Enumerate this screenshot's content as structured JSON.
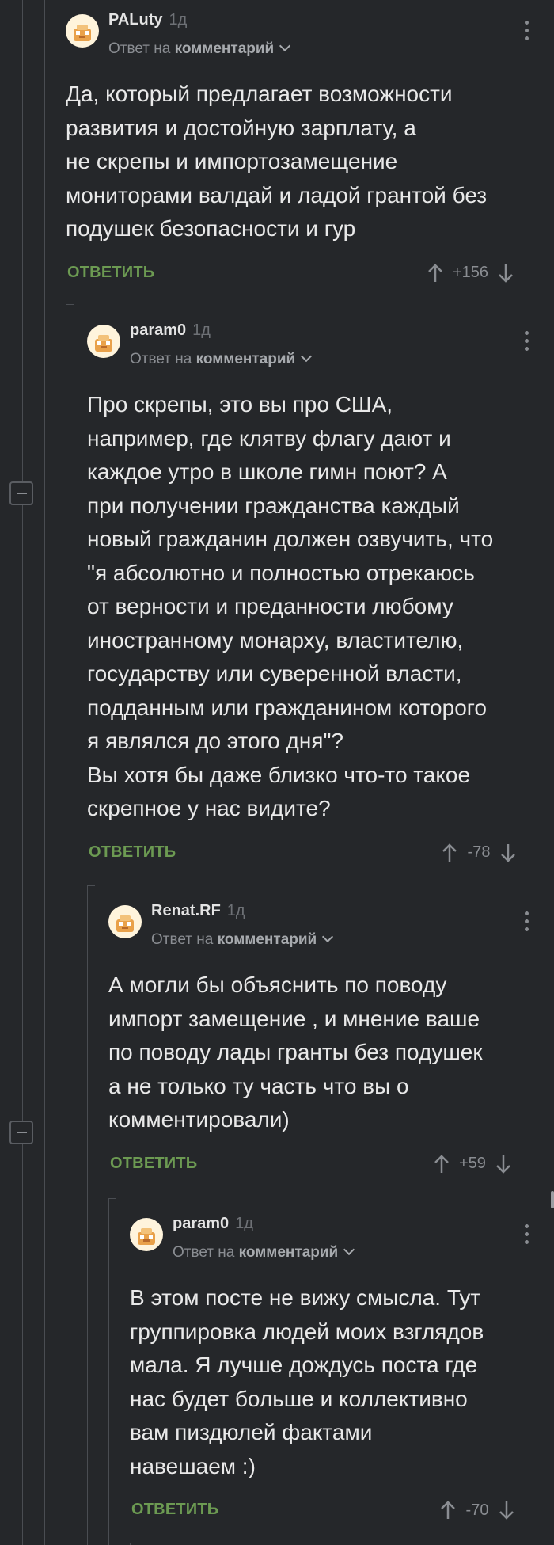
{
  "comments": [
    {
      "author": "PALuty",
      "time": "1д",
      "reply_prefix": "Ответ на",
      "reply_target": "комментарий",
      "text": "Да, который предлагает возможности\nразвития и достойную зарплату, а\nне скрепы и импортозамещение\nмониторами валдай и ладой грантой без\nподушек безопасности и гур",
      "reply_label": "ОТВЕТИТЬ",
      "score": "+156"
    },
    {
      "author": "param0",
      "time": "1д",
      "reply_prefix": "Ответ на",
      "reply_target": "комментарий",
      "text": "Про скрепы, это вы про США,\nнапример, где клятву флагу дают и\nкаждое утро в школе гимн поют? А\nпри получении гражданства каждый\nновый гражданин должен озвучить, что\n\"я абсолютно и полностью отрекаюсь\nот верности и преданности любому\nиностранному монарху, властителю,\nгосударству или суверенной власти,\nподданным или гражданином которого\nя являлся до этого дня\"?\nВы хотя бы даже близко что-то такое\nскрепное у нас видите?",
      "reply_label": "ОТВЕТИТЬ",
      "score": "-78"
    },
    {
      "author": "Renat.RF",
      "time": "1д",
      "reply_prefix": "Ответ на",
      "reply_target": "комментарий",
      "text": "А могли бы объяснить по поводу\nимпорт замещение , и  мнение ваше\nпо поводу лады гранты без подушек\nа не только ту часть что вы о\nкомментировали)",
      "reply_label": "ОТВЕТИТЬ",
      "score": "+59"
    },
    {
      "author": "param0",
      "time": "1д",
      "reply_prefix": "Ответ на",
      "reply_target": "комментарий",
      "text": "В этом посте не вижу смысла. Тут\nгруппировка людей моих взглядов\nмала. Я лучше дождусь поста где\nнас будет больше и коллективно\nвам пиздюлей фактами\nнавешаем :)",
      "reply_label": "ОТВЕТИТЬ",
      "score": "-70"
    }
  ],
  "colors": {
    "background": "#25272a",
    "reply_button": "#6c9a52",
    "thread_line": "#4a4d52"
  },
  "icons": [
    "avatar-icon",
    "upvote-icon",
    "downvote-icon",
    "more-options-icon",
    "chevron-down-icon",
    "collapse-thread-icon"
  ]
}
